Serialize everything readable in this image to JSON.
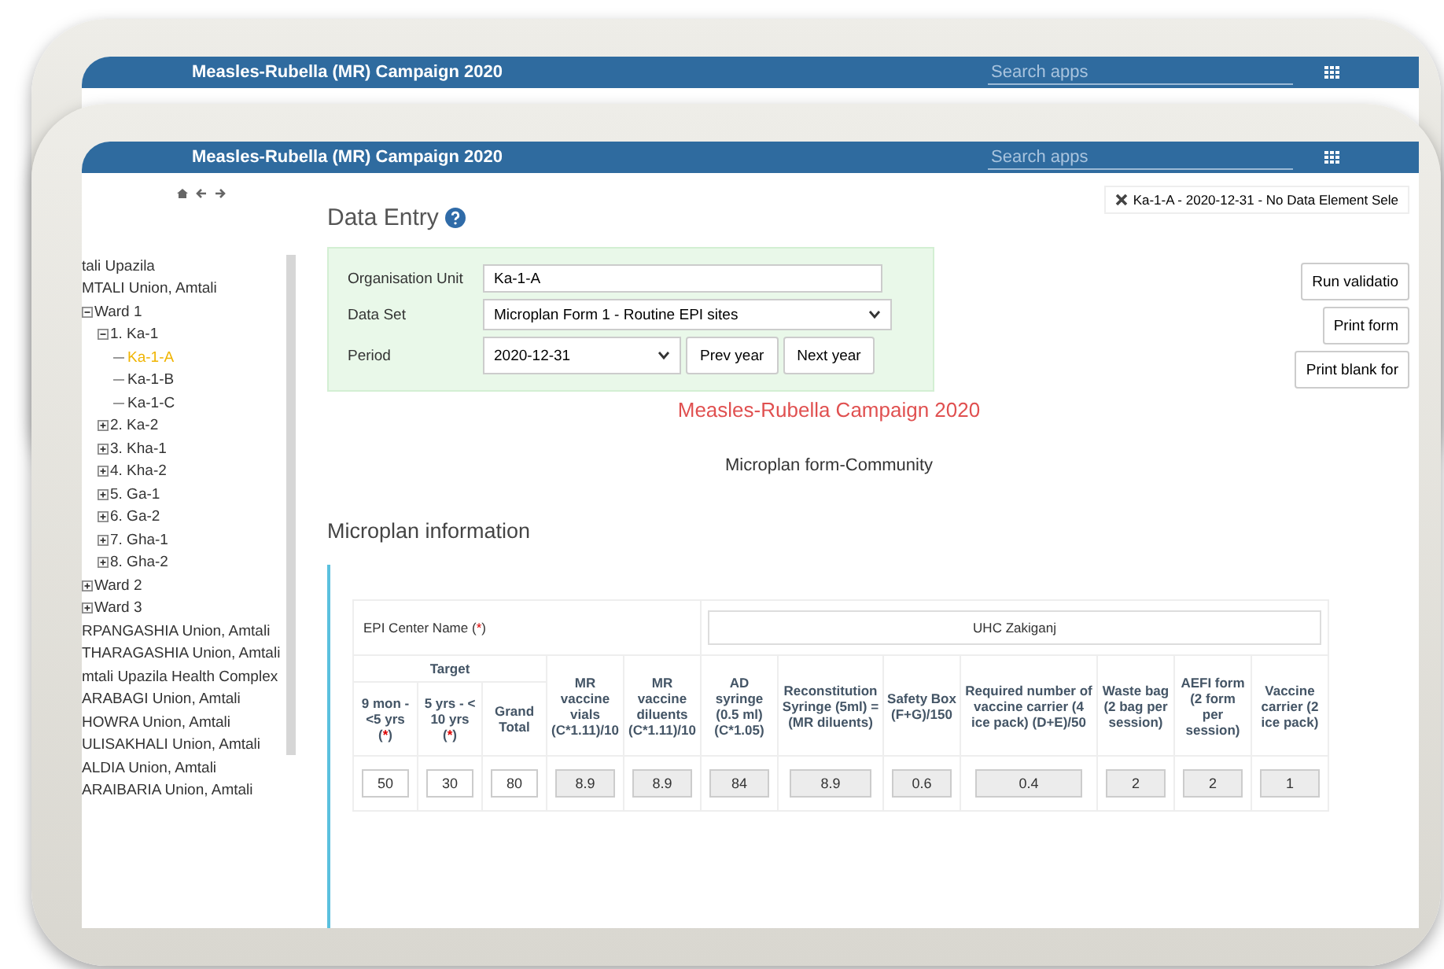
{
  "back_window": {
    "title": "Measles-Rubella (MR) Campaign 2020",
    "search": {
      "placeholder": "Search apps"
    }
  },
  "header": {
    "title": "Measles-Rubella (MR) Campaign 2020",
    "search": {
      "placeholder": "Search apps"
    }
  },
  "tree": [
    {
      "label": "tali Upazila",
      "selected": false
    },
    {
      "label": "MTALI Union, Amtali",
      "selected": false
    },
    {
      "label": "Ward 1",
      "selected": false,
      "expanded": true,
      "children": [
        {
          "label": "1. Ka-1",
          "selected": false,
          "expanded": true,
          "children": [
            {
              "label": "Ka-1-A",
              "selected": true
            },
            {
              "label": "Ka-1-B",
              "selected": false
            },
            {
              "label": "Ka-1-C",
              "selected": false
            }
          ]
        },
        {
          "label": "2. Ka-2",
          "selected": false,
          "expanded": false
        },
        {
          "label": "3. Kha-1",
          "selected": false,
          "expanded": false
        },
        {
          "label": "4. Kha-2",
          "selected": false,
          "expanded": false
        },
        {
          "label": "5. Ga-1",
          "selected": false,
          "expanded": false
        },
        {
          "label": "6. Ga-2",
          "selected": false,
          "expanded": false
        },
        {
          "label": "7. Gha-1",
          "selected": false,
          "expanded": false
        },
        {
          "label": "8. Gha-2",
          "selected": false,
          "expanded": false
        }
      ]
    },
    {
      "label": "Ward 2",
      "selected": false,
      "expanded": false
    },
    {
      "label": "Ward 3",
      "selected": false,
      "expanded": false
    },
    {
      "label": "RPANGASHIA Union, Amtali",
      "selected": false
    },
    {
      "label": "THARAGASHIA Union, Amtali",
      "selected": false
    },
    {
      "label": "mtali Upazila Health Complex",
      "selected": false
    },
    {
      "label": "ARABAGI Union, Amtali",
      "selected": false
    },
    {
      "label": "HOWRA Union, Amtali",
      "selected": false
    },
    {
      "label": "ULISAKHALI Union, Amtali",
      "selected": false
    },
    {
      "label": "ALDIA Union, Amtali",
      "selected": false
    },
    {
      "label": "ARAIBARIA Union, Amtali",
      "selected": false
    }
  ],
  "page_title": "Data Entry",
  "selection_info": "Ka-1-A - 2020-12-31 - No Data Element Sele",
  "form": {
    "org_unit": {
      "label": "Organisation Unit",
      "value": "Ka-1-A"
    },
    "data_set": {
      "label": "Data Set",
      "value": "Microplan Form 1 - Routine EPI sites"
    },
    "period": {
      "label": "Period",
      "value": "2020-12-31"
    },
    "buttons": [
      "Prev year",
      "Next year"
    ]
  },
  "side_buttons": [
    "Run validatio",
    "Print form",
    "Print blank for"
  ],
  "campaign_title": "Measles-Rubella Campaign 2020",
  "form_title": "Microplan form-Community",
  "section_title": "Microplan information",
  "table": {
    "center_label": "EPI Center Name",
    "center_mark": "(*)",
    "center_value": "UHC Zakiganj",
    "target": {
      "label": "Target",
      "columns": [
        {
          "label": "9 mon - <5 yrs",
          "mark": "(*)"
        },
        {
          "label": "5 yrs - < 10 yrs",
          "mark": "(*)"
        },
        {
          "label": "Grand Total"
        }
      ]
    },
    "columns": [
      {
        "label": "MR vaccine vials (C*1.11)/10"
      },
      {
        "label": "MR vaccine diluents (C*1.11)/10"
      },
      {
        "label": "AD syringe (0.5 ml) (C*1.05)"
      },
      {
        "label": "Reconstitution Syringe (5ml) = (MR diluents)"
      },
      {
        "label": "Safety Box (F+G)/150"
      },
      {
        "label": "Required number of vaccine carrier (4 ice pack) (D+E)/50"
      },
      {
        "label": "Waste bag (2 bag per session)"
      },
      {
        "label": "AEFI form (2 form per session)"
      },
      {
        "label": "Vaccine carrier (2 ice pack)"
      }
    ],
    "values": [
      {
        "value": "50",
        "kind": "input"
      },
      {
        "value": "30",
        "kind": "input"
      },
      {
        "value": "80",
        "kind": "input"
      },
      {
        "value": "8.9",
        "kind": "computed"
      },
      {
        "value": "8.9",
        "kind": "computed"
      },
      {
        "value": "84",
        "kind": "computed"
      },
      {
        "value": "8.9",
        "kind": "computed"
      },
      {
        "value": "0.6",
        "kind": "computed"
      },
      {
        "value": "0.4",
        "kind": "computed"
      },
      {
        "value": "2",
        "kind": "computed"
      },
      {
        "value": "2",
        "kind": "computed"
      },
      {
        "value": "1",
        "kind": "computed"
      }
    ]
  }
}
